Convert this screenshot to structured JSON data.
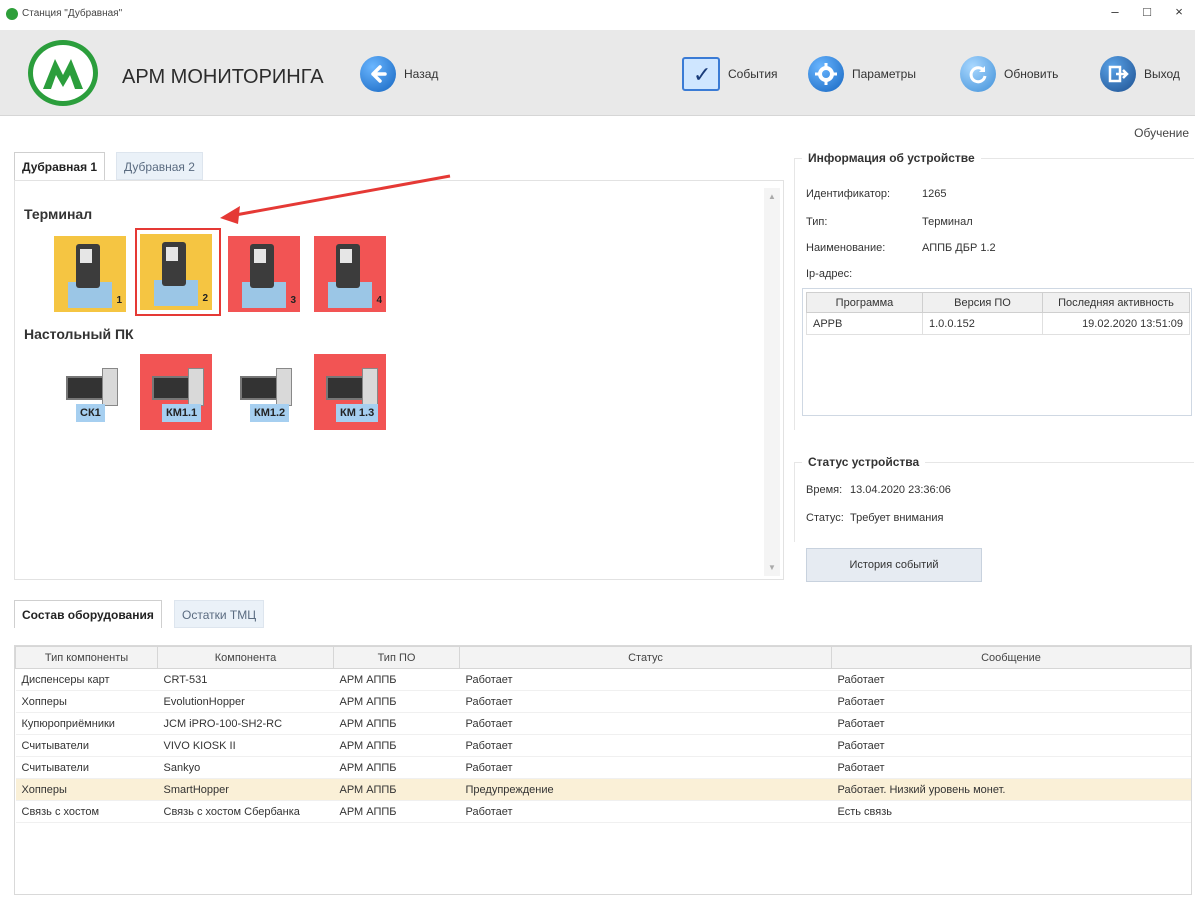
{
  "window": {
    "title": "Станция \"Дубравная\"",
    "controls": {
      "minimize": "–",
      "maximize": "□",
      "close": "×"
    }
  },
  "header": {
    "app_title": "АРМ МОНИТОРИНГА",
    "back_label": "Назад",
    "events_label": "События",
    "params_label": "Параметры",
    "refresh_label": "Обновить",
    "exit_label": "Выход",
    "brand_color": "#2b9e3c"
  },
  "mode_label": "Обучение",
  "station_tabs": [
    {
      "label": "Дубравная 1",
      "active": true
    },
    {
      "label": "Дубравная 2",
      "active": false
    }
  ],
  "devices": {
    "terminal_title": "Терминал",
    "terminals": [
      {
        "num": "1",
        "status": "yellow"
      },
      {
        "num": "2",
        "status": "yellow",
        "selected": true
      },
      {
        "num": "3",
        "status": "red"
      },
      {
        "num": "4",
        "status": "red"
      }
    ],
    "pc_title": "Настольный ПК",
    "pcs": [
      {
        "label": "СК1",
        "status": "white"
      },
      {
        "label": "КМ1.1",
        "status": "red"
      },
      {
        "label": "КМ1.2",
        "status": "white"
      },
      {
        "label": "КМ 1.3",
        "status": "red"
      }
    ]
  },
  "device_info": {
    "title": "Информация об устройстве",
    "id_label": "Идентификатор:",
    "id_value": "1265",
    "type_label": "Тип:",
    "type_value": "Терминал",
    "name_label": "Наименование:",
    "name_value": "АППБ ДБР 1.2",
    "ip_label": "Ip-адрес:",
    "software_columns": [
      "Программа",
      "Версия ПО",
      "Последняя активность"
    ],
    "software_rows": [
      [
        "APPB",
        "1.0.0.152",
        "19.02.2020 13:51:09"
      ]
    ]
  },
  "device_status": {
    "title": "Статус устройства",
    "time_label": "Время:",
    "time_value": "13.04.2020 23:36:06",
    "status_label": "Статус:",
    "status_value": "Требует внимания",
    "history_button": "История событий"
  },
  "bottom_tabs": [
    {
      "label": "Состав оборудования",
      "active": true
    },
    {
      "label": "Остатки ТМЦ",
      "active": false
    }
  ],
  "equipment": {
    "columns": [
      "Тип компоненты",
      "Компонента",
      "Тип ПО",
      "Статус",
      "Сообщение"
    ],
    "rows": [
      [
        "Диспенсеры карт",
        "CRT-531",
        "АРМ АППБ",
        "Работает",
        "Работает"
      ],
      [
        "Хопперы",
        "EvolutionHopper",
        "АРМ АППБ",
        "Работает",
        "Работает"
      ],
      [
        "Купюроприёмники",
        "JCM iPRO-100-SH2-RC",
        "АРМ АППБ",
        "Работает",
        "Работает"
      ],
      [
        "Считыватели",
        "VIVO KIOSK II",
        "АРМ АППБ",
        "Работает",
        "Работает"
      ],
      [
        "Считыватели",
        "Sankyo",
        "АРМ АППБ",
        "Работает",
        "Работает"
      ],
      [
        "Хопперы",
        "SmartHopper",
        "АРМ АППБ",
        "Предупреждение",
        "Работает. Низкий уровень монет."
      ],
      [
        "Связь с хостом",
        "Связь с хостом Сбербанка",
        "АРМ АППБ",
        "Работает",
        "Есть связь"
      ]
    ],
    "warning_color": "#faf0d7"
  },
  "colors": {
    "yellow_status": "#f5c542",
    "red_status": "#f25454",
    "annotation_arrow": "#e53935"
  }
}
